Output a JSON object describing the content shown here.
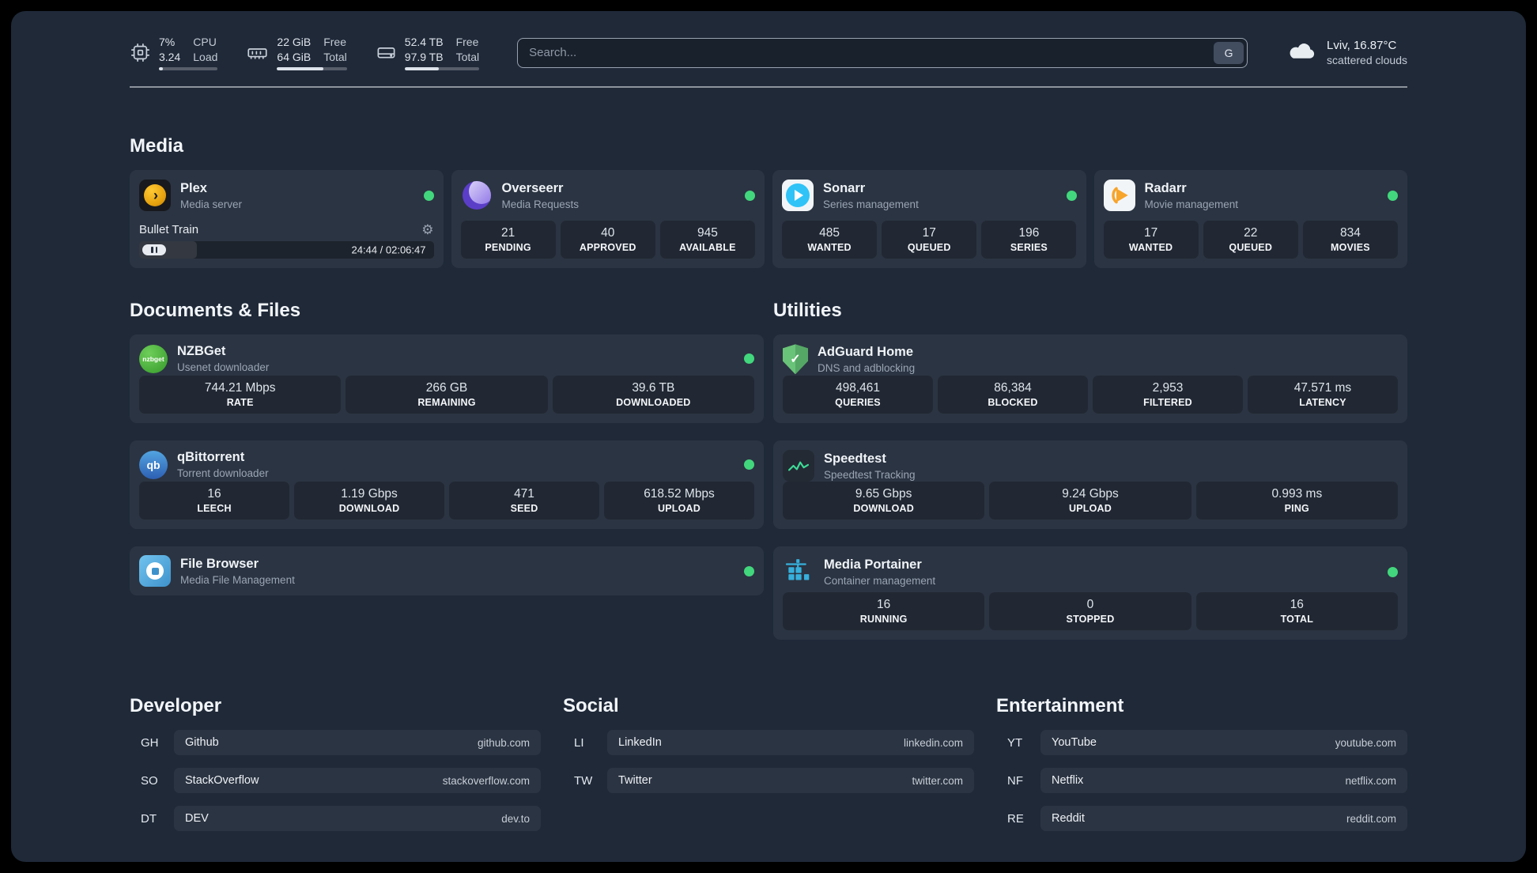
{
  "topbar": {
    "resources": [
      {
        "values": [
          "7%",
          "3.24"
        ],
        "labels": [
          "CPU",
          "Load"
        ],
        "bar_pct": "7"
      },
      {
        "values": [
          "22 GiB",
          "64 GiB"
        ],
        "labels": [
          "Free",
          "Total"
        ],
        "bar_pct": "66"
      },
      {
        "values": [
          "52.4 TB",
          "97.9 TB"
        ],
        "labels": [
          "Free",
          "Total"
        ],
        "bar_pct": "46"
      }
    ],
    "search": {
      "placeholder": "Search...",
      "provider_button": "G"
    },
    "weather": {
      "location": "Lviv, 16.87°C",
      "condition": "scattered clouds"
    }
  },
  "sections": {
    "media": {
      "title": "Media"
    },
    "documents": {
      "title": "Documents & Files"
    },
    "utilities": {
      "title": "Utilities"
    },
    "developer": {
      "title": "Developer"
    },
    "social": {
      "title": "Social"
    },
    "entertainment": {
      "title": "Entertainment"
    }
  },
  "services": {
    "plex": {
      "name": "Plex",
      "subtitle": "Media server",
      "now_playing": "Bullet Train",
      "time": "24:44 / 02:06:47",
      "progress_pct": "19.5"
    },
    "overseerr": {
      "name": "Overseerr",
      "subtitle": "Media Requests",
      "stats": [
        {
          "value": "21",
          "label": "PENDING"
        },
        {
          "value": "40",
          "label": "APPROVED"
        },
        {
          "value": "945",
          "label": "AVAILABLE"
        }
      ]
    },
    "sonarr": {
      "name": "Sonarr",
      "subtitle": "Series management",
      "stats": [
        {
          "value": "485",
          "label": "WANTED"
        },
        {
          "value": "17",
          "label": "QUEUED"
        },
        {
          "value": "196",
          "label": "SERIES"
        }
      ]
    },
    "radarr": {
      "name": "Radarr",
      "subtitle": "Movie management",
      "stats": [
        {
          "value": "17",
          "label": "WANTED"
        },
        {
          "value": "22",
          "label": "QUEUED"
        },
        {
          "value": "834",
          "label": "MOVIES"
        }
      ]
    },
    "nzbget": {
      "name": "NZBGet",
      "subtitle": "Usenet downloader",
      "stats": [
        {
          "value": "744.21 Mbps",
          "label": "RATE"
        },
        {
          "value": "266 GB",
          "label": "REMAINING"
        },
        {
          "value": "39.6 TB",
          "label": "DOWNLOADED"
        }
      ]
    },
    "qbittorrent": {
      "name": "qBittorrent",
      "subtitle": "Torrent downloader",
      "stats": [
        {
          "value": "16",
          "label": "LEECH"
        },
        {
          "value": "1.19 Gbps",
          "label": "DOWNLOAD"
        },
        {
          "value": "471",
          "label": "SEED"
        },
        {
          "value": "618.52 Mbps",
          "label": "UPLOAD"
        }
      ]
    },
    "filebrowser": {
      "name": "File Browser",
      "subtitle": "Media File Management"
    },
    "adguard": {
      "name": "AdGuard Home",
      "subtitle": "DNS and adblocking",
      "stats": [
        {
          "value": "498,461",
          "label": "QUERIES"
        },
        {
          "value": "86,384",
          "label": "BLOCKED"
        },
        {
          "value": "2,953",
          "label": "FILTERED"
        },
        {
          "value": "47.571 ms",
          "label": "LATENCY"
        }
      ]
    },
    "speedtest": {
      "name": "Speedtest",
      "subtitle": "Speedtest Tracking",
      "stats": [
        {
          "value": "9.65 Gbps",
          "label": "DOWNLOAD"
        },
        {
          "value": "9.24 Gbps",
          "label": "UPLOAD"
        },
        {
          "value": "0.993 ms",
          "label": "PING"
        }
      ]
    },
    "portainer": {
      "name": "Media Portainer",
      "subtitle": "Container management",
      "stats": [
        {
          "value": "16",
          "label": "RUNNING"
        },
        {
          "value": "0",
          "label": "STOPPED"
        },
        {
          "value": "16",
          "label": "TOTAL"
        }
      ]
    }
  },
  "bookmarks": {
    "developer": [
      {
        "abbr": "GH",
        "name": "Github",
        "url": "github.com"
      },
      {
        "abbr": "SO",
        "name": "StackOverflow",
        "url": "stackoverflow.com"
      },
      {
        "abbr": "DT",
        "name": "DEV",
        "url": "dev.to"
      }
    ],
    "social": [
      {
        "abbr": "LI",
        "name": "LinkedIn",
        "url": "linkedin.com"
      },
      {
        "abbr": "TW",
        "name": "Twitter",
        "url": "twitter.com"
      }
    ],
    "entertainment": [
      {
        "abbr": "YT",
        "name": "YouTube",
        "url": "youtube.com"
      },
      {
        "abbr": "NF",
        "name": "Netflix",
        "url": "netflix.com"
      },
      {
        "abbr": "RE",
        "name": "Reddit",
        "url": "reddit.com"
      }
    ]
  },
  "icons": {
    "gear": "⚙",
    "check": "✓",
    "plex_chevron": "›",
    "nzbget_label": "nzbget",
    "qbittorrent_label": "qb",
    "cpu": "chip-outline",
    "memory": "ram-outline",
    "disk": "drive-outline",
    "cloud": "cloud-filled",
    "status_dot": "green-circle"
  },
  "colors": {
    "status_ok": "#42d77d",
    "background": "#1f2938"
  }
}
